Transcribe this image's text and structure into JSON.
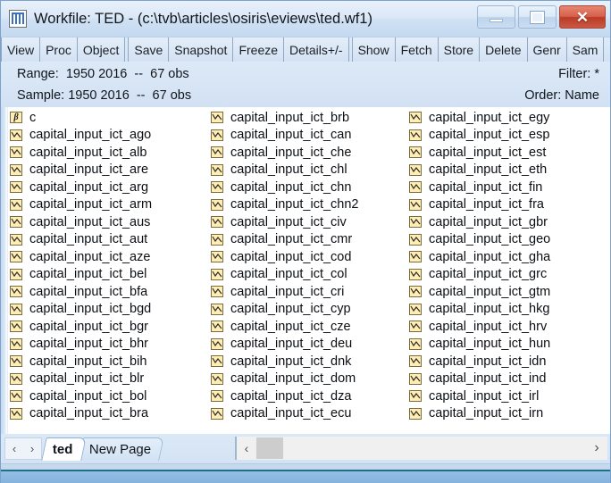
{
  "window": {
    "title": "Workfile: TED - (c:\\tvb\\articles\\osiris\\eviews\\ted.wf1)",
    "icon": "workfile-grid-icon",
    "minimize_label": "–",
    "maximize_label": "□",
    "close_label": "✕"
  },
  "toolbar": {
    "buttons": [
      {
        "label": "View"
      },
      {
        "label": "Proc"
      },
      {
        "label": "Object"
      },
      {
        "label": "Save"
      },
      {
        "label": "Snapshot"
      },
      {
        "label": "Freeze"
      },
      {
        "label": "Details+/-"
      },
      {
        "label": "Show"
      },
      {
        "label": "Fetch"
      },
      {
        "label": "Store"
      },
      {
        "label": "Delete"
      },
      {
        "label": "Genr"
      },
      {
        "label": "Sam"
      }
    ]
  },
  "info": {
    "range_label": "Range:  1950 2016  --  67 obs",
    "sample_label": "Sample: 1950 2016  --  67 obs",
    "filter_label": "Filter: *",
    "order_label": "Order: Name"
  },
  "objects": {
    "columns": [
      {
        "items": [
          {
            "name": "c",
            "type": "coef"
          },
          {
            "name": "capital_input_ict_ago",
            "type": "series"
          },
          {
            "name": "capital_input_ict_alb",
            "type": "series"
          },
          {
            "name": "capital_input_ict_are",
            "type": "series"
          },
          {
            "name": "capital_input_ict_arg",
            "type": "series"
          },
          {
            "name": "capital_input_ict_arm",
            "type": "series"
          },
          {
            "name": "capital_input_ict_aus",
            "type": "series"
          },
          {
            "name": "capital_input_ict_aut",
            "type": "series"
          },
          {
            "name": "capital_input_ict_aze",
            "type": "series"
          },
          {
            "name": "capital_input_ict_bel",
            "type": "series"
          },
          {
            "name": "capital_input_ict_bfa",
            "type": "series"
          },
          {
            "name": "capital_input_ict_bgd",
            "type": "series"
          },
          {
            "name": "capital_input_ict_bgr",
            "type": "series"
          },
          {
            "name": "capital_input_ict_bhr",
            "type": "series"
          },
          {
            "name": "capital_input_ict_bih",
            "type": "series"
          },
          {
            "name": "capital_input_ict_blr",
            "type": "series"
          },
          {
            "name": "capital_input_ict_bol",
            "type": "series"
          },
          {
            "name": "capital_input_ict_bra",
            "type": "series"
          }
        ]
      },
      {
        "items": [
          {
            "name": "capital_input_ict_brb",
            "type": "series"
          },
          {
            "name": "capital_input_ict_can",
            "type": "series"
          },
          {
            "name": "capital_input_ict_che",
            "type": "series"
          },
          {
            "name": "capital_input_ict_chl",
            "type": "series"
          },
          {
            "name": "capital_input_ict_chn",
            "type": "series"
          },
          {
            "name": "capital_input_ict_chn2",
            "type": "series"
          },
          {
            "name": "capital_input_ict_civ",
            "type": "series"
          },
          {
            "name": "capital_input_ict_cmr",
            "type": "series"
          },
          {
            "name": "capital_input_ict_cod",
            "type": "series"
          },
          {
            "name": "capital_input_ict_col",
            "type": "series"
          },
          {
            "name": "capital_input_ict_cri",
            "type": "series"
          },
          {
            "name": "capital_input_ict_cyp",
            "type": "series"
          },
          {
            "name": "capital_input_ict_cze",
            "type": "series"
          },
          {
            "name": "capital_input_ict_deu",
            "type": "series"
          },
          {
            "name": "capital_input_ict_dnk",
            "type": "series"
          },
          {
            "name": "capital_input_ict_dom",
            "type": "series"
          },
          {
            "name": "capital_input_ict_dza",
            "type": "series"
          },
          {
            "name": "capital_input_ict_ecu",
            "type": "series"
          }
        ]
      },
      {
        "items": [
          {
            "name": "capital_input_ict_egy",
            "type": "series"
          },
          {
            "name": "capital_input_ict_esp",
            "type": "series"
          },
          {
            "name": "capital_input_ict_est",
            "type": "series"
          },
          {
            "name": "capital_input_ict_eth",
            "type": "series"
          },
          {
            "name": "capital_input_ict_fin",
            "type": "series"
          },
          {
            "name": "capital_input_ict_fra",
            "type": "series"
          },
          {
            "name": "capital_input_ict_gbr",
            "type": "series"
          },
          {
            "name": "capital_input_ict_geo",
            "type": "series"
          },
          {
            "name": "capital_input_ict_gha",
            "type": "series"
          },
          {
            "name": "capital_input_ict_grc",
            "type": "series"
          },
          {
            "name": "capital_input_ict_gtm",
            "type": "series"
          },
          {
            "name": "capital_input_ict_hkg",
            "type": "series"
          },
          {
            "name": "capital_input_ict_hrv",
            "type": "series"
          },
          {
            "name": "capital_input_ict_hun",
            "type": "series"
          },
          {
            "name": "capital_input_ict_idn",
            "type": "series"
          },
          {
            "name": "capital_input_ict_ind",
            "type": "series"
          },
          {
            "name": "capital_input_ict_irl",
            "type": "series"
          },
          {
            "name": "capital_input_ict_irn",
            "type": "series"
          }
        ]
      }
    ]
  },
  "bottom": {
    "nav_prev": "‹",
    "nav_next": "›",
    "tabs": [
      {
        "label": "ted",
        "active": true
      },
      {
        "label": "New Page",
        "active": false
      }
    ],
    "scroll_left": "‹",
    "scroll_right": "›"
  },
  "colors": {
    "title_text": "#11161c",
    "object_icon_fill": "#ffeeb4",
    "object_icon_border": "#7a6a40",
    "close_button": "#c0392b",
    "accent_blue": "#86b3de"
  }
}
